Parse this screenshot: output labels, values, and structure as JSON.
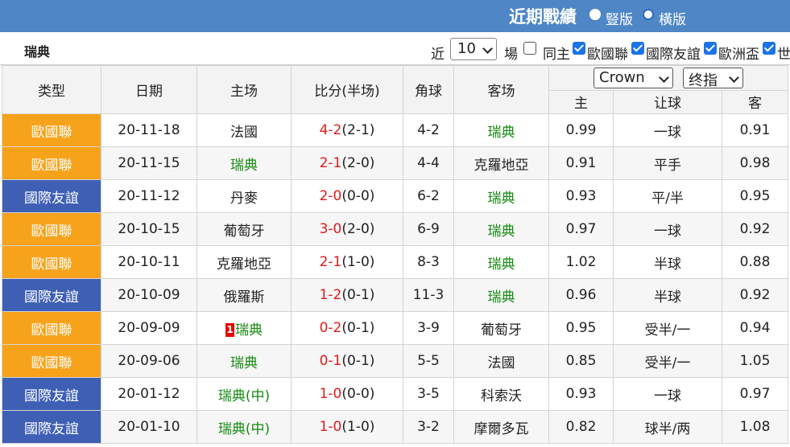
{
  "header": {
    "title": "近期戰績",
    "radio_vertical": "豎版",
    "radio_horizontal": "橫版"
  },
  "toolbar": {
    "team": "瑞典",
    "recent_prefix": "近",
    "recent_count": "10",
    "recent_suffix": "場",
    "filters": [
      {
        "label": "同主",
        "checked": false
      },
      {
        "label": "歐國聯",
        "checked": true
      },
      {
        "label": "國際友誼",
        "checked": true
      },
      {
        "label": "歐洲盃",
        "checked": true
      },
      {
        "label": "世",
        "checked": true
      }
    ]
  },
  "table": {
    "headers": {
      "type": "类型",
      "date": "日期",
      "home": "主场",
      "score": "比分(半场)",
      "corners": "角球",
      "away": "客场",
      "company": "Crown",
      "odds_type": "终指",
      "odds_home": "主",
      "odds_handicap": "让球",
      "odds_away": "客"
    },
    "rows": [
      {
        "type": "歐國聯",
        "type_color": "orange",
        "date": "20-11-18",
        "home": "法國",
        "home_green": false,
        "home_badge": "",
        "score": "4-2",
        "half": "(2-1)",
        "corners": "4-2",
        "away": "瑞典",
        "away_green": true,
        "odds_home": "0.99",
        "handicap": "一球",
        "odds_away": "0.91"
      },
      {
        "type": "歐國聯",
        "type_color": "orange",
        "date": "20-11-15",
        "home": "瑞典",
        "home_green": true,
        "home_badge": "",
        "score": "2-1",
        "half": "(2-0)",
        "corners": "4-4",
        "away": "克羅地亞",
        "away_green": false,
        "odds_home": "0.91",
        "handicap": "平手",
        "odds_away": "0.98"
      },
      {
        "type": "國際友誼",
        "type_color": "blue",
        "date": "20-11-12",
        "home": "丹麥",
        "home_green": false,
        "home_badge": "",
        "score": "2-0",
        "half": "(0-0)",
        "corners": "6-2",
        "away": "瑞典",
        "away_green": true,
        "odds_home": "0.93",
        "handicap": "平/半",
        "odds_away": "0.95"
      },
      {
        "type": "歐國聯",
        "type_color": "orange",
        "date": "20-10-15",
        "home": "葡萄牙",
        "home_green": false,
        "home_badge": "",
        "score": "3-0",
        "half": "(2-0)",
        "corners": "6-9",
        "away": "瑞典",
        "away_green": true,
        "odds_home": "0.97",
        "handicap": "一球",
        "odds_away": "0.92"
      },
      {
        "type": "歐國聯",
        "type_color": "orange",
        "date": "20-10-11",
        "home": "克羅地亞",
        "home_green": false,
        "home_badge": "",
        "score": "2-1",
        "half": "(1-0)",
        "corners": "8-3",
        "away": "瑞典",
        "away_green": true,
        "odds_home": "1.02",
        "handicap": "半球",
        "odds_away": "0.88"
      },
      {
        "type": "國際友誼",
        "type_color": "blue",
        "date": "20-10-09",
        "home": "俄羅斯",
        "home_green": false,
        "home_badge": "",
        "score": "1-2",
        "half": "(0-1)",
        "corners": "11-3",
        "away": "瑞典",
        "away_green": true,
        "odds_home": "0.96",
        "handicap": "半球",
        "odds_away": "0.92"
      },
      {
        "type": "歐國聯",
        "type_color": "orange",
        "date": "20-09-09",
        "home": "瑞典",
        "home_green": true,
        "home_badge": "1",
        "score": "0-2",
        "half": "(0-1)",
        "corners": "3-9",
        "away": "葡萄牙",
        "away_green": false,
        "odds_home": "0.95",
        "handicap": "受半/一",
        "odds_away": "0.94"
      },
      {
        "type": "歐國聯",
        "type_color": "orange",
        "date": "20-09-06",
        "home": "瑞典",
        "home_green": true,
        "home_badge": "",
        "score": "0-1",
        "half": "(0-1)",
        "corners": "5-5",
        "away": "法國",
        "away_green": false,
        "odds_home": "0.85",
        "handicap": "受半/一",
        "odds_away": "1.05"
      },
      {
        "type": "國際友誼",
        "type_color": "blue",
        "date": "20-01-12",
        "home": "瑞典(中)",
        "home_green": true,
        "home_badge": "",
        "score": "1-0",
        "half": "(0-0)",
        "corners": "3-5",
        "away": "科索沃",
        "away_green": false,
        "odds_home": "0.93",
        "handicap": "一球",
        "odds_away": "0.97"
      },
      {
        "type": "國際友誼",
        "type_color": "blue",
        "date": "20-01-10",
        "home": "瑞典(中)",
        "home_green": true,
        "home_badge": "",
        "score": "1-0",
        "half": "(1-0)",
        "corners": "3-2",
        "away": "摩爾多瓦",
        "away_green": false,
        "odds_home": "0.82",
        "handicap": "球半/两",
        "odds_away": "1.08"
      }
    ]
  }
}
